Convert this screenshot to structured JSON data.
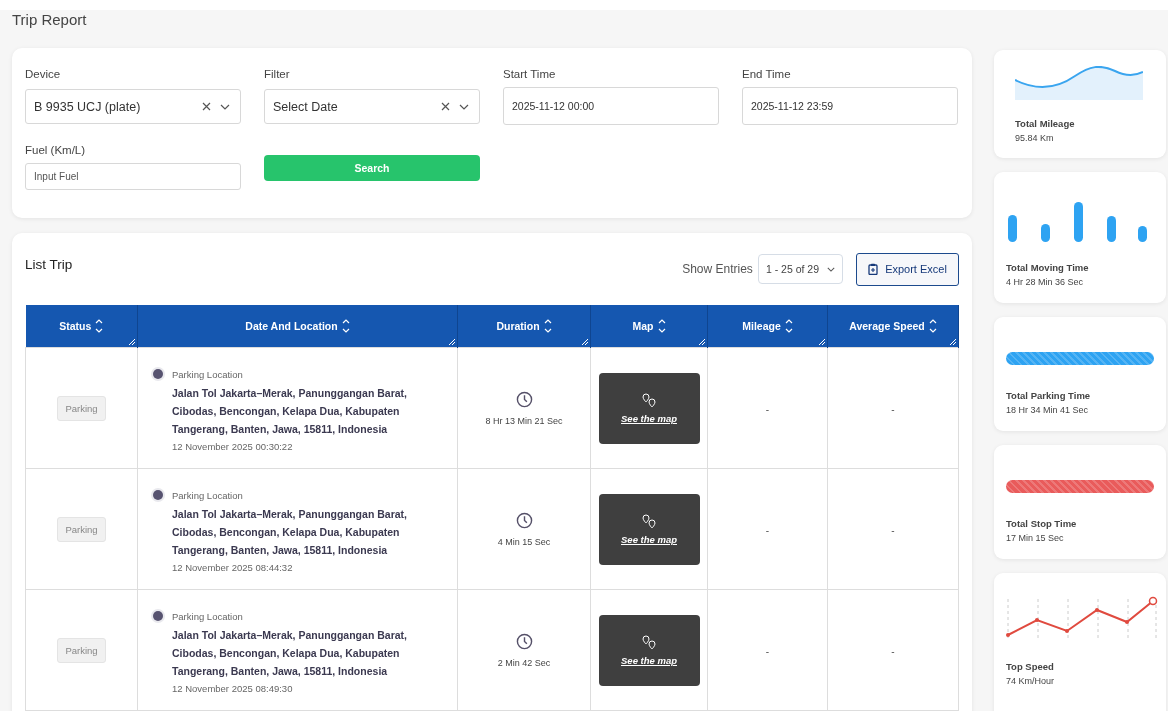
{
  "page_title": "Trip Report",
  "filters": {
    "device": {
      "label": "Device",
      "value": "B 9935 UCJ (plate)"
    },
    "filter": {
      "label": "Filter",
      "value": "Select Date"
    },
    "start_time": {
      "label": "Start Time",
      "value": "2025-11-12 00:00"
    },
    "end_time": {
      "label": "End Time",
      "value": "2025-11-12 23:59"
    },
    "fuel": {
      "label": "Fuel (Km/L)",
      "placeholder": "Input Fuel"
    },
    "search_button": "Search"
  },
  "list_trip": {
    "title": "List Trip",
    "show_entries_label": "Show Entries",
    "entries_value": "1 - 25 of 29",
    "export_button": "Export Excel"
  },
  "table": {
    "columns": [
      "Status",
      "Date And Location",
      "Duration",
      "Map",
      "Mileage",
      "Average Speed"
    ],
    "rows": [
      {
        "status": "Parking",
        "location_label": "Parking Location",
        "address": "Jalan Tol Jakarta–Merak, Panunggangan Barat, Cibodas, Bencongan, Kelapa Dua, Kabupaten Tangerang, Banten, Jawa, 15811, Indonesia",
        "timestamp": "12 November 2025 00:30:22",
        "duration": "8 Hr 13 Min 21 Sec",
        "map_link": "See the map",
        "mileage": "-",
        "average_speed": "-"
      },
      {
        "status": "Parking",
        "location_label": "Parking Location",
        "address": "Jalan Tol Jakarta–Merak, Panunggangan Barat, Cibodas, Bencongan, Kelapa Dua, Kabupaten Tangerang, Banten, Jawa, 15811, Indonesia",
        "timestamp": "12 November 2025 08:44:32",
        "duration": "4 Min 15 Sec",
        "map_link": "See the map",
        "mileage": "-",
        "average_speed": "-"
      },
      {
        "status": "Parking",
        "location_label": "Parking Location",
        "address": "Jalan Tol Jakarta–Merak, Panunggangan Barat, Cibodas, Bencongan, Kelapa Dua, Kabupaten Tangerang, Banten, Jawa, 15811, Indonesia",
        "timestamp": "12 November 2025 08:49:30",
        "duration": "2 Min 42 Sec",
        "map_link": "See the map",
        "mileage": "-",
        "average_speed": "-"
      }
    ]
  },
  "stats": [
    {
      "kind": "wave",
      "label": "Total Mileage",
      "value": "95.84 Km"
    },
    {
      "kind": "bars",
      "label": "Total Moving Time",
      "value": "4 Hr 28 Min 36 Sec"
    },
    {
      "kind": "stripe",
      "color": "#2ea3f2",
      "label": "Total Parking Time",
      "value": "18 Hr 34 Min 41 Sec"
    },
    {
      "kind": "stripe",
      "color": "#e95b5b",
      "label": "Total Stop Time",
      "value": "17 Min 15 Sec"
    },
    {
      "kind": "line",
      "label": "Top Speed",
      "value": "74 Km/Hour"
    }
  ]
}
